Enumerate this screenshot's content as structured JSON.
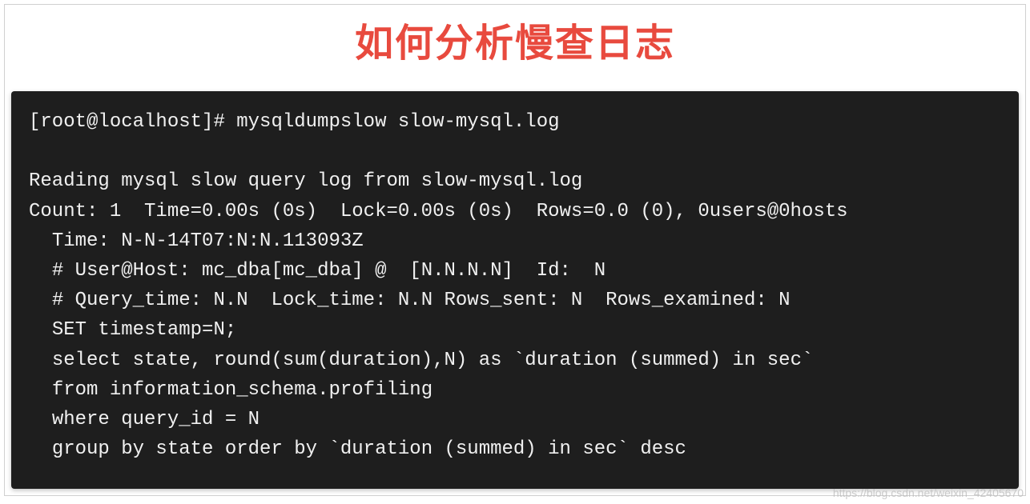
{
  "header": {
    "title": "如何分析慢查日志"
  },
  "terminal": {
    "lines": [
      "[root@localhost]# mysqldumpslow slow-mysql.log",
      "",
      "Reading mysql slow query log from slow-mysql.log",
      "Count: 1  Time=0.00s (0s)  Lock=0.00s (0s)  Rows=0.0 (0), 0users@0hosts",
      "  Time: N-N-14T07:N:N.113093Z",
      "  # User@Host: mc_dba[mc_dba] @  [N.N.N.N]  Id:  N",
      "  # Query_time: N.N  Lock_time: N.N Rows_sent: N  Rows_examined: N",
      "  SET timestamp=N;",
      "  select state, round(sum(duration),N) as `duration (summed) in sec`",
      "  from information_schema.profiling",
      "  where query_id = N",
      "  group by state order by `duration (summed) in sec` desc"
    ]
  },
  "watermark": "https://blog.csdn.net/weixin_42405670"
}
